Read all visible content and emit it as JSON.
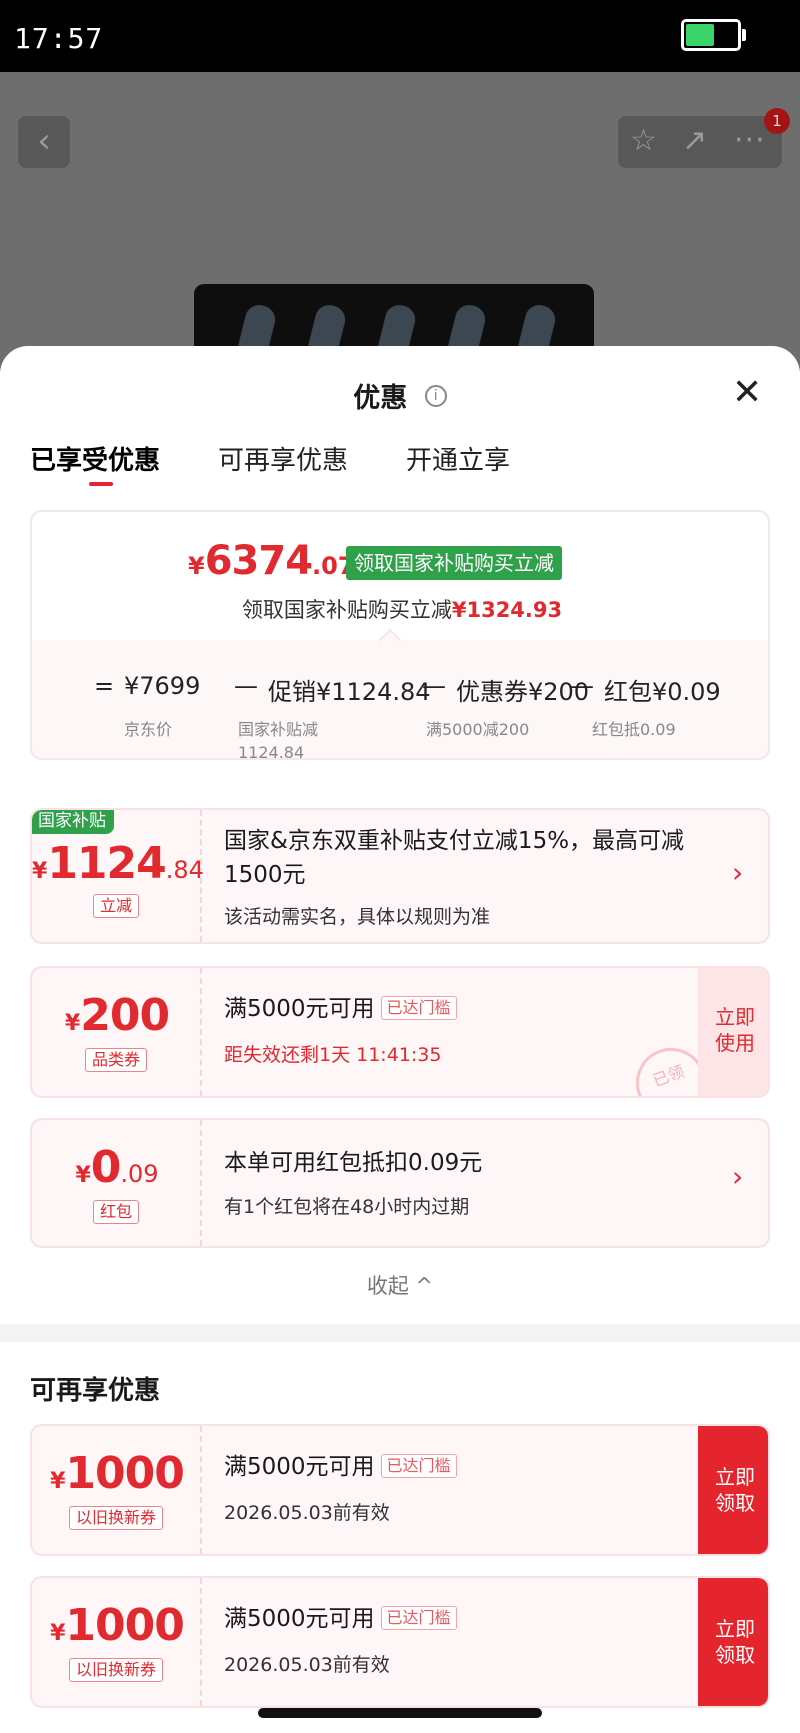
{
  "status_bar": {
    "time": "17:57",
    "battery_level": 0.55
  },
  "background_page": {
    "back_icon": "‹",
    "star_icon": "☆",
    "share_icon": "↗",
    "more_icon": "···",
    "notification_count": "1"
  },
  "sheet": {
    "title": "优惠",
    "info_icon": "i",
    "close_icon": "✕",
    "tabs": [
      {
        "label": "已享受优惠",
        "active": true
      },
      {
        "label": "可再享优惠",
        "active": false
      },
      {
        "label": "开通立享",
        "active": false
      }
    ]
  },
  "summary": {
    "price_yen": "¥",
    "price_int": "6374",
    "price_dec": ".07",
    "tag": "领取国家补贴购买立减",
    "sub_text": "领取国家补贴购买立减",
    "sub_amount": "¥1324.93",
    "formula": {
      "equals": "=",
      "base": "¥7699",
      "minus": "—",
      "promo": "促销¥1124.84",
      "coupon": "优惠券¥200",
      "redpacket": "红包¥0.09",
      "base_label": "京东价",
      "promo_label_1": "国家补贴减",
      "promo_label_2": "1124.84",
      "coupon_label": "满5000减200",
      "redpacket_label": "红包抵0.09"
    }
  },
  "enjoyed_offers": [
    {
      "badge": "国家补贴",
      "yen": "¥",
      "int": "1124",
      "dec": ".84",
      "tag": "立减",
      "title": "国家&京东双重补贴支付立减15%，最高可减1500元",
      "sub": "该活动需实名，具体以规则为准",
      "chevron": "›"
    },
    {
      "yen": "¥",
      "int": "200",
      "dec": "",
      "tag": "品类券",
      "title": "满5000元可用",
      "reach_tag": "已达门槛",
      "sub": "距失效还剩1天 11:41:35",
      "button_1": "立即",
      "button_2": "使用",
      "stamp": "已领"
    },
    {
      "yen": "¥",
      "int": "0",
      "dec": ".09",
      "tag": "红包",
      "title": "本单可用红包抵扣0.09元",
      "sub": "有1个红包将在48小时内过期",
      "chevron": "›"
    }
  ],
  "collapse_label": "收起 ^",
  "more_section_title": "可再享优惠",
  "more_offers": [
    {
      "yen": "¥",
      "int": "1000",
      "tag": "以旧换新券",
      "title": "满5000元可用",
      "reach_tag": "已达门槛",
      "sub": "2026.05.03前有效",
      "button_1": "立即",
      "button_2": "领取"
    },
    {
      "yen": "¥",
      "int": "1000",
      "tag": "以旧换新券",
      "title": "满5000元可用",
      "reach_tag": "已达门槛",
      "sub": "2026.05.03前有效",
      "button_1": "立即",
      "button_2": "领取"
    }
  ],
  "colors": {
    "accent_red": "#e4252d",
    "price_red": "#e02a2f",
    "subsidy_green": "#2fa14b"
  }
}
